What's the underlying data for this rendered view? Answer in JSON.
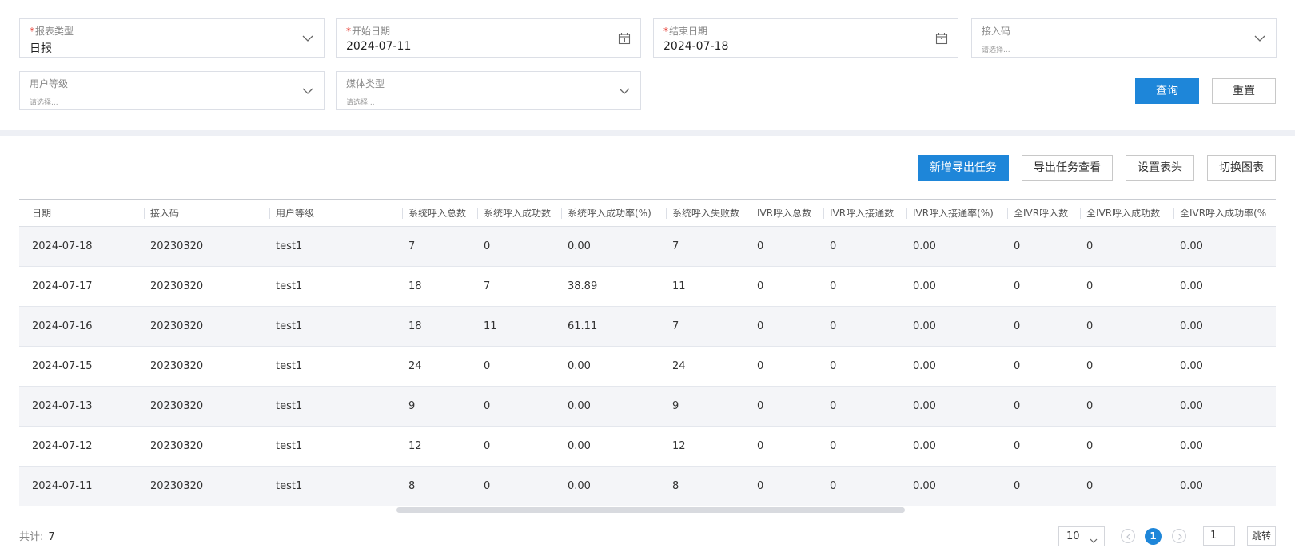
{
  "filters": {
    "report_type": {
      "label": "报表类型",
      "value": "日报",
      "required": true
    },
    "start_date": {
      "label": "开始日期",
      "value": "2024-07-11",
      "required": true
    },
    "end_date": {
      "label": "结束日期",
      "value": "2024-07-18",
      "required": true
    },
    "access_code": {
      "label": "接入码",
      "placeholder": "请选择..."
    },
    "user_level": {
      "label": "用户等级",
      "placeholder": "请选择..."
    },
    "media_type": {
      "label": "媒体类型",
      "placeholder": "请选择..."
    }
  },
  "actions": {
    "query": "查询",
    "reset": "重置"
  },
  "toolbar": {
    "new_export": "新增导出任务",
    "view_export": "导出任务查看",
    "set_header": "设置表头",
    "switch_chart": "切换图表"
  },
  "table": {
    "columns": [
      "日期",
      "接入码",
      "用户等级",
      "系统呼入总数",
      "系统呼入成功数",
      "系统呼入成功率(%)",
      "系统呼入失败数",
      "IVR呼入总数",
      "IVR呼入接通数",
      "IVR呼入接通率(%)",
      "全IVR呼入数",
      "全IVR呼入成功数",
      "全IVR呼入成功率(%"
    ],
    "rows": [
      [
        "2024-07-18",
        "20230320",
        "test1",
        "7",
        "0",
        "0.00",
        "7",
        "0",
        "0",
        "0.00",
        "0",
        "0",
        "0.00"
      ],
      [
        "2024-07-17",
        "20230320",
        "test1",
        "18",
        "7",
        "38.89",
        "11",
        "0",
        "0",
        "0.00",
        "0",
        "0",
        "0.00"
      ],
      [
        "2024-07-16",
        "20230320",
        "test1",
        "18",
        "11",
        "61.11",
        "7",
        "0",
        "0",
        "0.00",
        "0",
        "0",
        "0.00"
      ],
      [
        "2024-07-15",
        "20230320",
        "test1",
        "24",
        "0",
        "0.00",
        "24",
        "0",
        "0",
        "0.00",
        "0",
        "0",
        "0.00"
      ],
      [
        "2024-07-13",
        "20230320",
        "test1",
        "9",
        "0",
        "0.00",
        "9",
        "0",
        "0",
        "0.00",
        "0",
        "0",
        "0.00"
      ],
      [
        "2024-07-12",
        "20230320",
        "test1",
        "12",
        "0",
        "0.00",
        "12",
        "0",
        "0",
        "0.00",
        "0",
        "0",
        "0.00"
      ],
      [
        "2024-07-11",
        "20230320",
        "test1",
        "8",
        "0",
        "0.00",
        "8",
        "0",
        "0",
        "0.00",
        "0",
        "0",
        "0.00"
      ]
    ]
  },
  "footer": {
    "total_label": "共计:",
    "total_value": "7",
    "page_size": "10",
    "current_page": "1",
    "jump_value": "1",
    "jump_label": "跳转"
  },
  "colors": {
    "primary": "#1e86d9",
    "required_mark": "#e6352b",
    "row_alt": "#f4f5f8"
  },
  "icons": {
    "dropdown": "chevron-down-icon",
    "date": "calendar-icon",
    "prev": "chevron-left-icon",
    "next": "chevron-right-icon"
  }
}
